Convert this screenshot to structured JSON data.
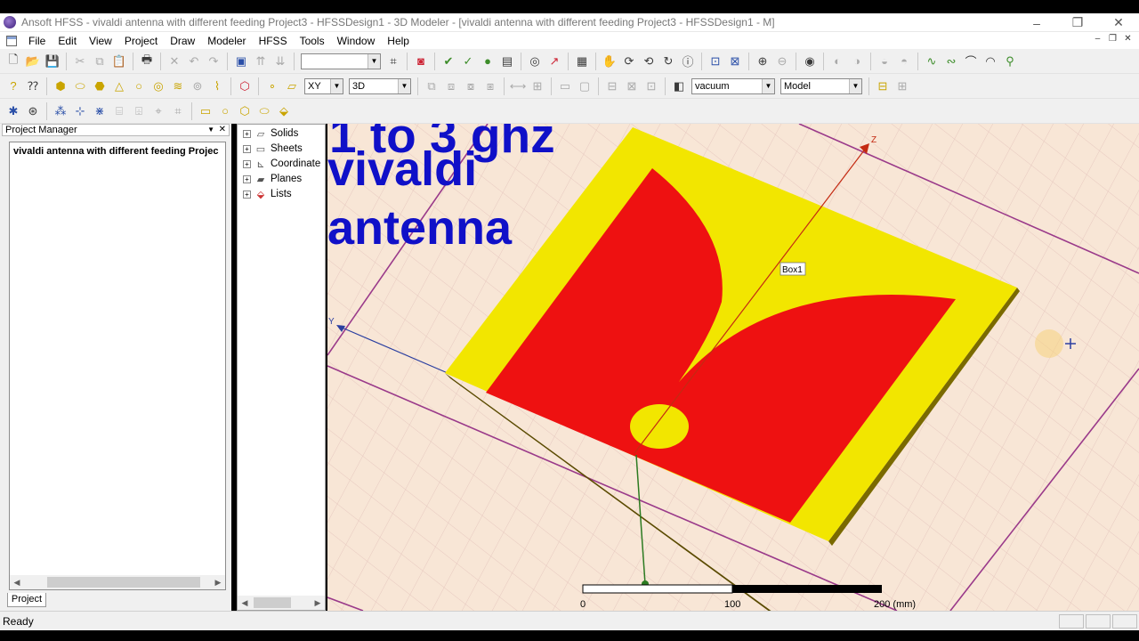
{
  "window": {
    "title": "Ansoft HFSS  - vivaldi antenna with different feeding Project3 - HFSSDesign1 - 3D Modeler - [vivaldi antenna with different feeding Project3 - HFSSDesign1 - M]"
  },
  "menu": [
    "File",
    "Edit",
    "View",
    "Project",
    "Draw",
    "Modeler",
    "HFSS",
    "Tools",
    "Window",
    "Help"
  ],
  "toolbar": {
    "plane_select": "XY",
    "dimension_select": "3D",
    "material_select": "vacuum",
    "model_select": "Model"
  },
  "project_manager": {
    "title": "Project Manager",
    "root_item": "vivaldi antenna with different feeding Projec",
    "tab": "Project"
  },
  "history_tree": {
    "items": [
      "Solids",
      "Sheets",
      "Coordinate",
      "Planes",
      "Lists"
    ]
  },
  "overlay": {
    "line1": "1  to  3  ghz",
    "line2": "vivaldi",
    "line3": "antenna"
  },
  "viewport": {
    "object_label": "Box1",
    "z_axis_label": "Z",
    "y_axis_label": "Y",
    "scale_ticks": [
      "0",
      "100",
      "200 (mm)"
    ],
    "colors": {
      "background": "#f8e6d6",
      "substrate": "#f2e600",
      "patch": "#ee1111",
      "grid_line": "#9a3a8a",
      "overlay_text": "#1010c8"
    }
  },
  "status": {
    "text": "Ready"
  }
}
